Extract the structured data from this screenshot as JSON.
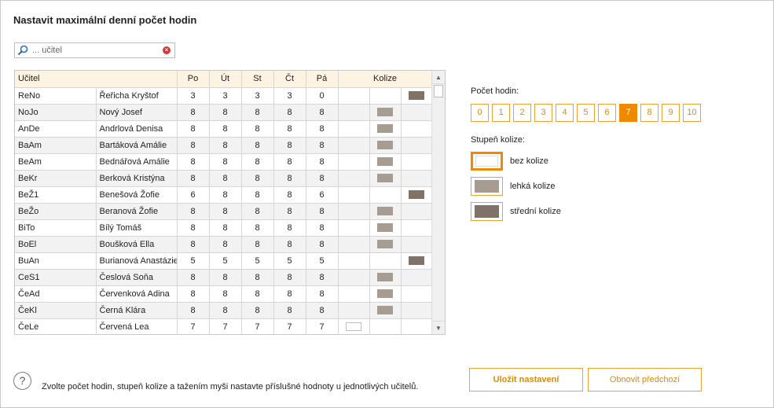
{
  "title": "Nastavit maximální denní počet hodin",
  "search": {
    "placeholder": "... učitel",
    "value": ""
  },
  "table": {
    "headers": {
      "teacher": "Učitel",
      "days": [
        "Po",
        "Út",
        "St",
        "Čt",
        "Pá"
      ],
      "collision": "Kolize"
    },
    "rows": [
      {
        "code": "ReNo",
        "name": "Řeřicha Kryštof",
        "hours": [
          "3",
          "3",
          "3",
          "3",
          "0"
        ],
        "collision": "medium"
      },
      {
        "code": "NoJo",
        "name": "Nový Josef",
        "hours": [
          "8",
          "8",
          "8",
          "8",
          "8"
        ],
        "collision": "light"
      },
      {
        "code": "AnDe",
        "name": "Andrlová Denisa",
        "hours": [
          "8",
          "8",
          "8",
          "8",
          "8"
        ],
        "collision": "light"
      },
      {
        "code": "BaAm",
        "name": "Bartáková Amálie",
        "hours": [
          "8",
          "8",
          "8",
          "8",
          "8"
        ],
        "collision": "light"
      },
      {
        "code": "BeAm",
        "name": "Bednářová Amálie",
        "hours": [
          "8",
          "8",
          "8",
          "8",
          "8"
        ],
        "collision": "light"
      },
      {
        "code": "BeKr",
        "name": "Berková Kristýna",
        "hours": [
          "8",
          "8",
          "8",
          "8",
          "8"
        ],
        "collision": "light"
      },
      {
        "code": "BeŽ1",
        "name": "Benešová Žofie",
        "hours": [
          "6",
          "8",
          "8",
          "8",
          "6"
        ],
        "collision": "medium"
      },
      {
        "code": "BeŽo",
        "name": "Beranová Žofie",
        "hours": [
          "8",
          "8",
          "8",
          "8",
          "8"
        ],
        "collision": "light"
      },
      {
        "code": "BiTo",
        "name": "Bílý Tomáš",
        "hours": [
          "8",
          "8",
          "8",
          "8",
          "8"
        ],
        "collision": "light"
      },
      {
        "code": "BoEl",
        "name": "Boušková Ella",
        "hours": [
          "8",
          "8",
          "8",
          "8",
          "8"
        ],
        "collision": "light"
      },
      {
        "code": "BuAn",
        "name": "Burianová Anastázie",
        "hours": [
          "5",
          "5",
          "5",
          "5",
          "5"
        ],
        "collision": "medium"
      },
      {
        "code": "CeS1",
        "name": "Česlová Soňa",
        "hours": [
          "8",
          "8",
          "8",
          "8",
          "8"
        ],
        "collision": "light"
      },
      {
        "code": "ČeAd",
        "name": "Červenková Adina",
        "hours": [
          "8",
          "8",
          "8",
          "8",
          "8"
        ],
        "collision": "light"
      },
      {
        "code": "ČeKl",
        "name": "Černá Klára",
        "hours": [
          "8",
          "8",
          "8",
          "8",
          "8"
        ],
        "collision": "light"
      },
      {
        "code": "ČeLe",
        "name": "Červená Lea",
        "hours": [
          "7",
          "7",
          "7",
          "7",
          "7"
        ],
        "collision": "none"
      }
    ]
  },
  "hours_panel": {
    "label": "Počet hodin:",
    "options": [
      "0",
      "1",
      "2",
      "3",
      "4",
      "5",
      "6",
      "7",
      "8",
      "9",
      "10"
    ],
    "selected": "7"
  },
  "collision_panel": {
    "label": "Stupeň kolize:",
    "levels": [
      {
        "key": "none",
        "label": "bez kolize",
        "color": "#ffffff",
        "selected": true
      },
      {
        "key": "light",
        "label": "lehká kolize",
        "color": "#a79c92",
        "selected": false
      },
      {
        "key": "medium",
        "label": "střední kolize",
        "color": "#7f7266",
        "selected": false
      }
    ]
  },
  "help": {
    "icon": "question-icon",
    "text": "Zvolte počet hodin, stupeň kolize a tažením myši nastavte příslušné hodnoty u jednotlivých učitelů."
  },
  "buttons": {
    "save": "Uložit nastavení",
    "restore": "Obnovit předchozí"
  },
  "colors": {
    "accent": "#ef8a00",
    "header_bg": "#fdf3e3",
    "row_alt": "#f2f2f2"
  }
}
